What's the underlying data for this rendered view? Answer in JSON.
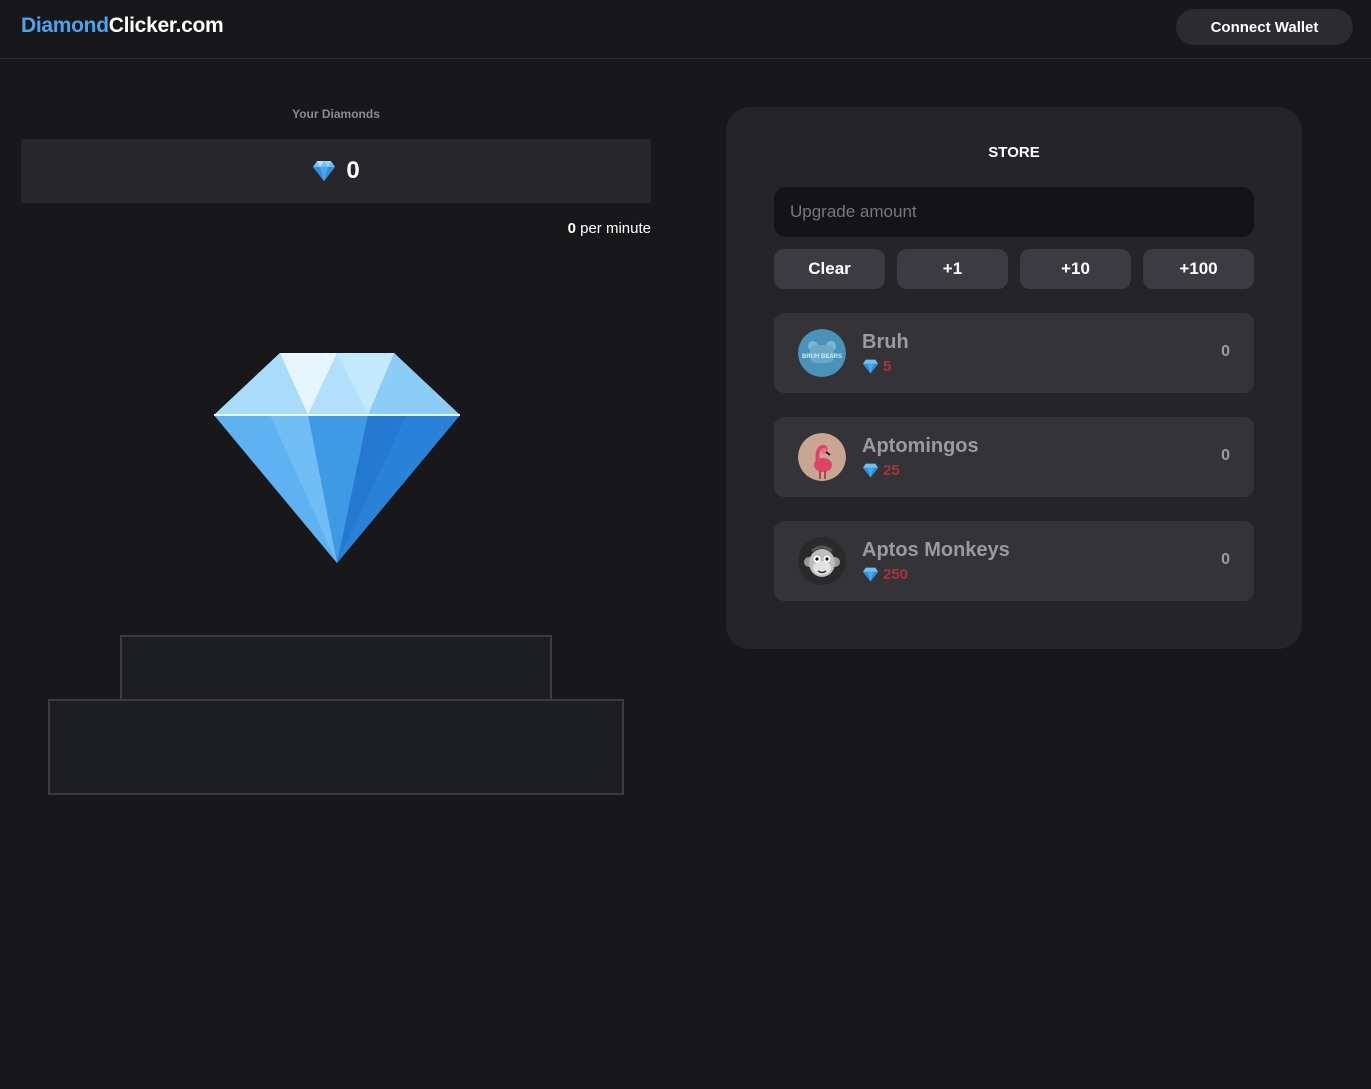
{
  "header": {
    "logo_accent": "Diamond",
    "logo_rest": "Clicker.com",
    "connect_wallet_label": "Connect Wallet"
  },
  "balance": {
    "label": "Your Diamonds",
    "value": "0",
    "rate_value": "0",
    "rate_suffix": " per minute"
  },
  "store": {
    "title": "STORE",
    "upgrade_placeholder": "Upgrade amount",
    "buttons": [
      "Clear",
      "+1",
      "+10",
      "+100"
    ],
    "items": [
      {
        "name": "Bruh",
        "price": "5",
        "owned": "0",
        "avatar": "bruh-bears-icon",
        "avatar_text": "BRUH BEARS"
      },
      {
        "name": "Aptomingos",
        "price": "25",
        "owned": "0",
        "avatar": "flamingo-icon"
      },
      {
        "name": "Aptos Monkeys",
        "price": "250",
        "owned": "0",
        "avatar": "monkey-icon"
      }
    ]
  },
  "colors": {
    "background": "#18181b",
    "accent": "#4ea3f0",
    "price": "#a8323a",
    "store_bg": "#252529"
  }
}
